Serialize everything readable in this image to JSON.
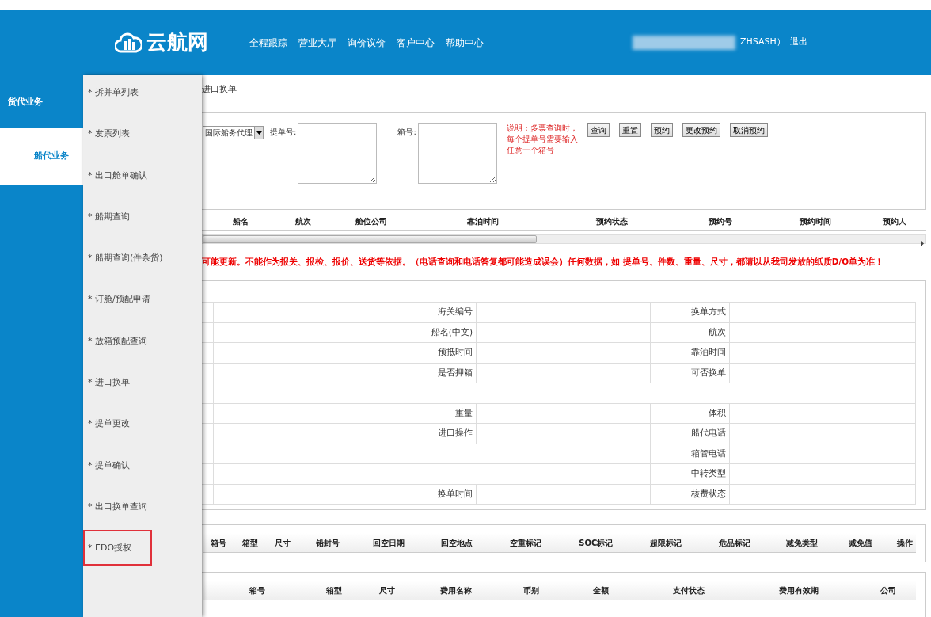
{
  "header": {
    "logo_text": "云航网",
    "nav": [
      "全程跟踪",
      "营业大厅",
      "询价议价",
      "客户中心",
      "帮助中心"
    ],
    "user_suffix": "ZHSASH）",
    "logout": "退出"
  },
  "sidebar": {
    "items": [
      {
        "label": "货代业务",
        "selected": false
      },
      {
        "label": "船代业务",
        "selected": true
      }
    ]
  },
  "flyout_menu": {
    "items": [
      {
        "label": "* 拆并单列表",
        "highlighted": false
      },
      {
        "label": "* 发票列表",
        "highlighted": false
      },
      {
        "label": "* 出口舱单确认",
        "highlighted": false
      },
      {
        "label": "* 船期查询",
        "highlighted": false
      },
      {
        "label": "* 船期查询(件杂货)",
        "highlighted": false
      },
      {
        "label": "* 订舱/预配申请",
        "highlighted": false
      },
      {
        "label": "* 放箱预配查询",
        "highlighted": false
      },
      {
        "label": "* 进口换单",
        "highlighted": false
      },
      {
        "label": "* 提单更改",
        "highlighted": false
      },
      {
        "label": "* 提单确认",
        "highlighted": false
      },
      {
        "label": "* 出口换单查询",
        "highlighted": false
      },
      {
        "label": "* EDO授权",
        "highlighted": true
      }
    ]
  },
  "breadcrumb": "进口换单",
  "search": {
    "company_value": "国际船务代理",
    "bill_label": "提单号:",
    "container_label": "箱号:",
    "note": "说明：多票查询时，每个提单号需要输入任意一个箱号",
    "buttons": [
      "查询",
      "重置",
      "预约",
      "更改预约",
      "取消预约"
    ]
  },
  "result_table": {
    "columns": [
      "船名",
      "航次",
      "舱位公司",
      "靠泊时间",
      "预约状态",
      "预约号",
      "预约时间",
      "预约人"
    ]
  },
  "warning": "可能更新。不能作为报关、报检、报价、送货等依据。（电话查询和电话答复都可能造成误会）任何数据，如 提单号、件数、重量、尺寸，都请以从我司发放的纸质D/O单为准！",
  "basic_info": {
    "rows": [
      {
        "kind": "pair",
        "middle": "海关编号",
        "right": "换单方式"
      },
      {
        "kind": "pair",
        "middle": "船名(中文)",
        "right": "航次"
      },
      {
        "kind": "pair",
        "middle": "预抵时间",
        "right": "靠泊时间"
      },
      {
        "kind": "pair",
        "middle": "是否押箱",
        "right": "可否换单"
      },
      {
        "kind": "full"
      },
      {
        "kind": "pair",
        "middle": "重量",
        "right": "体积"
      },
      {
        "kind": "pair",
        "middle": "进口操作",
        "right": "船代电话"
      },
      {
        "kind": "wide",
        "right": "箱管电话"
      },
      {
        "kind": "wide",
        "right": "中转类型"
      },
      {
        "kind": "pair",
        "middle": "换单时间",
        "right": "核费状态"
      }
    ]
  },
  "container_table": {
    "columns": [
      "箱号",
      "箱型",
      "尺寸",
      "铅封号",
      "回空日期",
      "回空地点",
      "空重标记",
      "SOC标记",
      "超限标记",
      "危品标记",
      "减免类型",
      "减免值",
      "操作"
    ]
  },
  "fee_table": {
    "columns": [
      "箱号",
      "箱型",
      "尺寸",
      "费用名称",
      "币别",
      "金额",
      "支付状态",
      "费用有效期",
      "公司"
    ]
  }
}
